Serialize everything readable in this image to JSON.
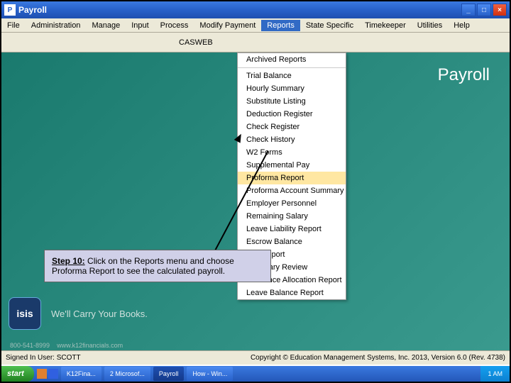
{
  "titlebar": {
    "title": "Payroll"
  },
  "menubar": [
    "File",
    "Administration",
    "Manage",
    "Input",
    "Process",
    "Modify Payment",
    "Reports",
    "State Specific",
    "Timekeeper",
    "Utilities",
    "Help"
  ],
  "header": {
    "server": "CASWEB"
  },
  "brand": "Payroll",
  "dropdown": {
    "top": "Archived Reports",
    "items": [
      "Trial Balance",
      "Hourly Summary",
      "Substitute Listing",
      "Deduction Register",
      "Check Register",
      "Check History",
      "W2 Forms",
      "Supplemental Pay",
      "Proforma Report",
      "Proforma Account Summary Report",
      "Employer Personnel",
      "Remaining Salary",
      "Leave Liability Report",
      "Escrow Balance",
      "941 Report",
      "Summary Review",
      "Insurance Allocation Report",
      "Leave Balance Report"
    ],
    "highlighted": "Proforma Report"
  },
  "callout": {
    "step": "Step 10:",
    "text": " Click on the Reports menu and choose Proforma Report to see the calculated payroll."
  },
  "tagline": "We'll Carry Your Books.",
  "logo": "isis",
  "phone": "800-541-8999",
  "url": "www.k12financials.com",
  "status": {
    "left": "Signed In User: SCOTT",
    "right": "Copyright © Education Management Systems, Inc. 2013, Version 6.0 (Rev. 4738)"
  },
  "taskbar": {
    "start": "start",
    "items": [
      "K12Fina...",
      "2 Microsof...",
      "Payroll",
      "How - Win..."
    ],
    "active": "Payroll",
    "time": "1 AM"
  }
}
